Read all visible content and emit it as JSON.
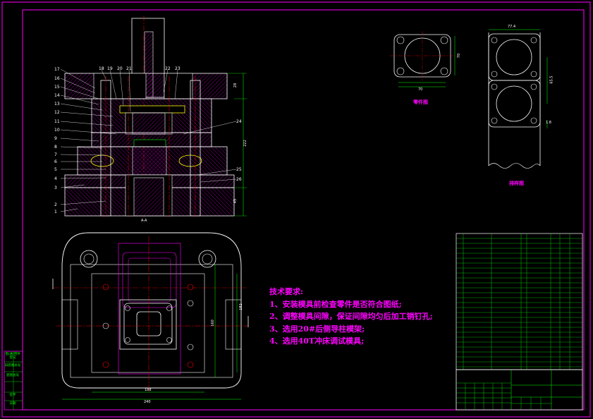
{
  "views": {
    "part_view_label": "零件图",
    "strip_view_label": "排样图",
    "section_label": "A-A",
    "part_dims": {
      "width": "70",
      "height": "70"
    },
    "strip_dims": {
      "width": "77.4",
      "pitch": "65.5",
      "edge": "1.8"
    },
    "plan_dims": {
      "width": "240",
      "inner_width": "188",
      "height": "182",
      "inner_height": "160"
    },
    "section_dims": {
      "height": "222",
      "top": "28",
      "bottom": "45"
    }
  },
  "section_callouts_left": [
    "17",
    "16",
    "15",
    "14",
    "13",
    "12",
    "11",
    "10",
    "9",
    "8",
    "7",
    "6",
    "5",
    "4",
    "3",
    "2",
    "1"
  ],
  "section_callouts_top": [
    "18",
    "19",
    "20",
    "21",
    "22",
    "23"
  ],
  "section_callouts_right": [
    "24",
    "25",
    "26"
  ],
  "technical_notes": {
    "title": "技术要求:",
    "items": [
      "1、安装模具前检查零件是否符合图纸;",
      "2、调整模具间隙，保证间隙均匀后加工销钉孔;",
      "3、选用20#后侧导柱模架;",
      "4、选用40T冲床调试模具;"
    ]
  },
  "left_tabs": [
    "借(通)用件登记",
    "旧底图总号",
    "底图总号",
    "签字",
    "日期"
  ],
  "colors": {
    "frame": "#ff00ff",
    "drawing": "#ffffff",
    "text": "#ff00ff",
    "table": "#00ff00",
    "centerline": "#ff0000",
    "insert": "#ffff00",
    "hatch": "#ff00ff"
  }
}
